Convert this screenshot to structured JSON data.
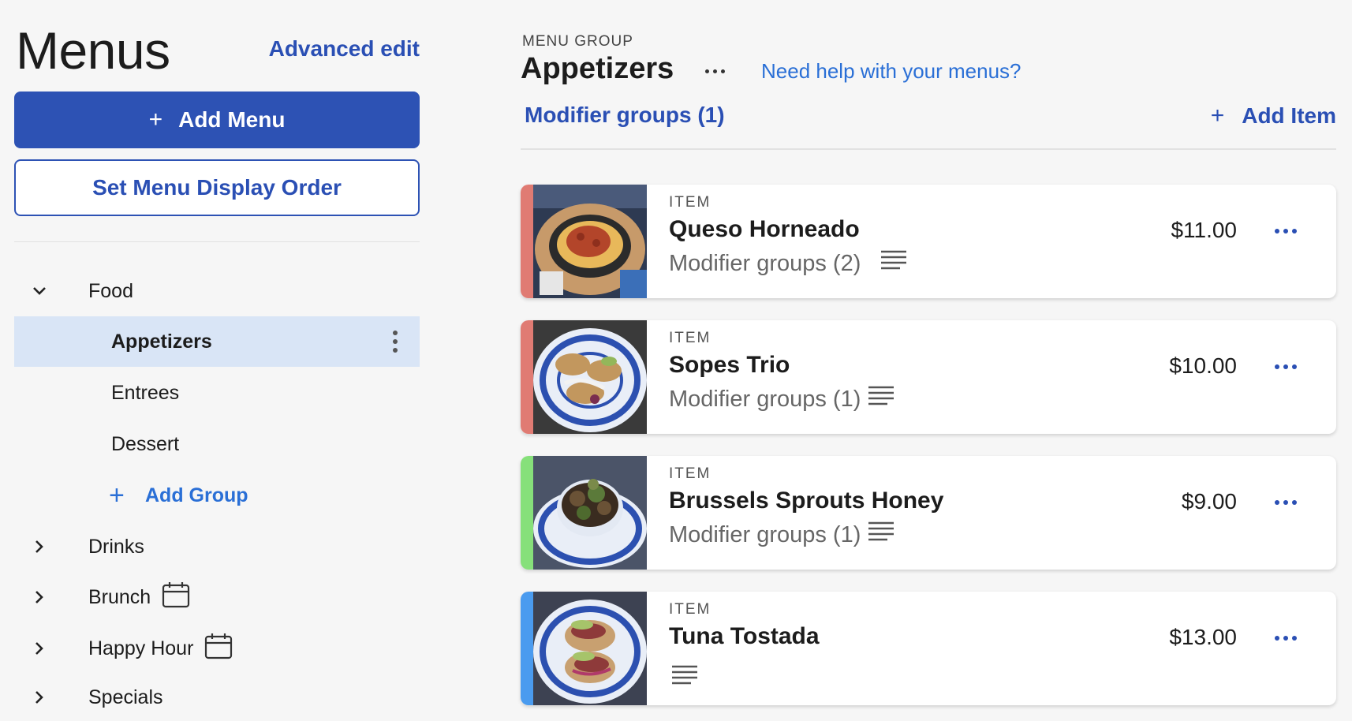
{
  "sidebar": {
    "title": "Menus",
    "advanced_edit": "Advanced edit",
    "add_menu": "Add Menu",
    "set_order": "Set Menu Display Order",
    "tree": {
      "food": "Food",
      "appetizers": "Appetizers",
      "entrees": "Entrees",
      "dessert": "Dessert",
      "add_group": "Add Group",
      "drinks": "Drinks",
      "brunch": "Brunch",
      "happy_hour": "Happy Hour",
      "specials": "Specials"
    }
  },
  "main": {
    "eyebrow": "MENU GROUP",
    "group_title": "Appetizers",
    "help_link": "Need help with your menus?",
    "modifier_link": "Modifier groups (1)",
    "add_item": "Add Item",
    "items": [
      {
        "kind": "ITEM",
        "name": "Queso Horneado",
        "modifiers": "Modifier groups (2)",
        "price": "$11.00",
        "stripe_color": "#e07b73"
      },
      {
        "kind": "ITEM",
        "name": "Sopes Trio",
        "modifiers": "Modifier groups (1)",
        "price": "$10.00",
        "stripe_color": "#e07b73"
      },
      {
        "kind": "ITEM",
        "name": "Brussels Sprouts Honey",
        "modifiers": "Modifier groups (1)",
        "price": "$9.00",
        "stripe_color": "#86e07a"
      },
      {
        "kind": "ITEM",
        "name": "Tuna Tostada",
        "modifiers": "",
        "price": "$13.00",
        "stripe_color": "#4a9bef"
      }
    ]
  },
  "colors": {
    "primary": "#2d52b4",
    "link": "#2a6fd6",
    "active_row": "#d9e5f6"
  }
}
